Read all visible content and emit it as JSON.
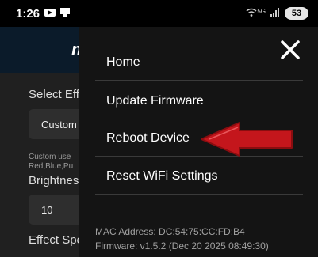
{
  "status": {
    "time": "1:26",
    "signal": "5G",
    "battery": "53"
  },
  "header": {
    "title_partial": "m"
  },
  "background": {
    "select_effect_label": "Select Effe",
    "effect_value": "Custom",
    "custom_hint_1": "Custom use",
    "custom_hint_2": "Red,Blue,Pu",
    "brightness_label": "Brightness",
    "brightness_value": "10",
    "effect_speed_label": "Effect Spe"
  },
  "menu": {
    "items": [
      {
        "label": "Home"
      },
      {
        "label": "Update Firmware"
      },
      {
        "label": "Reboot Device"
      },
      {
        "label": "Reset WiFi Settings"
      }
    ],
    "mac_address": "MAC Address: DC:54:75:CC:FD:B4",
    "firmware": "Firmware: v1.5.2 (Dec 20 2025 08:49:30)"
  },
  "icons": {
    "close": "close-icon",
    "annotation": "red-arrow-icon"
  },
  "colors": {
    "arrow": "#c4161c",
    "menu_bg": "#141414",
    "header_bg": "#0b1b2a"
  }
}
